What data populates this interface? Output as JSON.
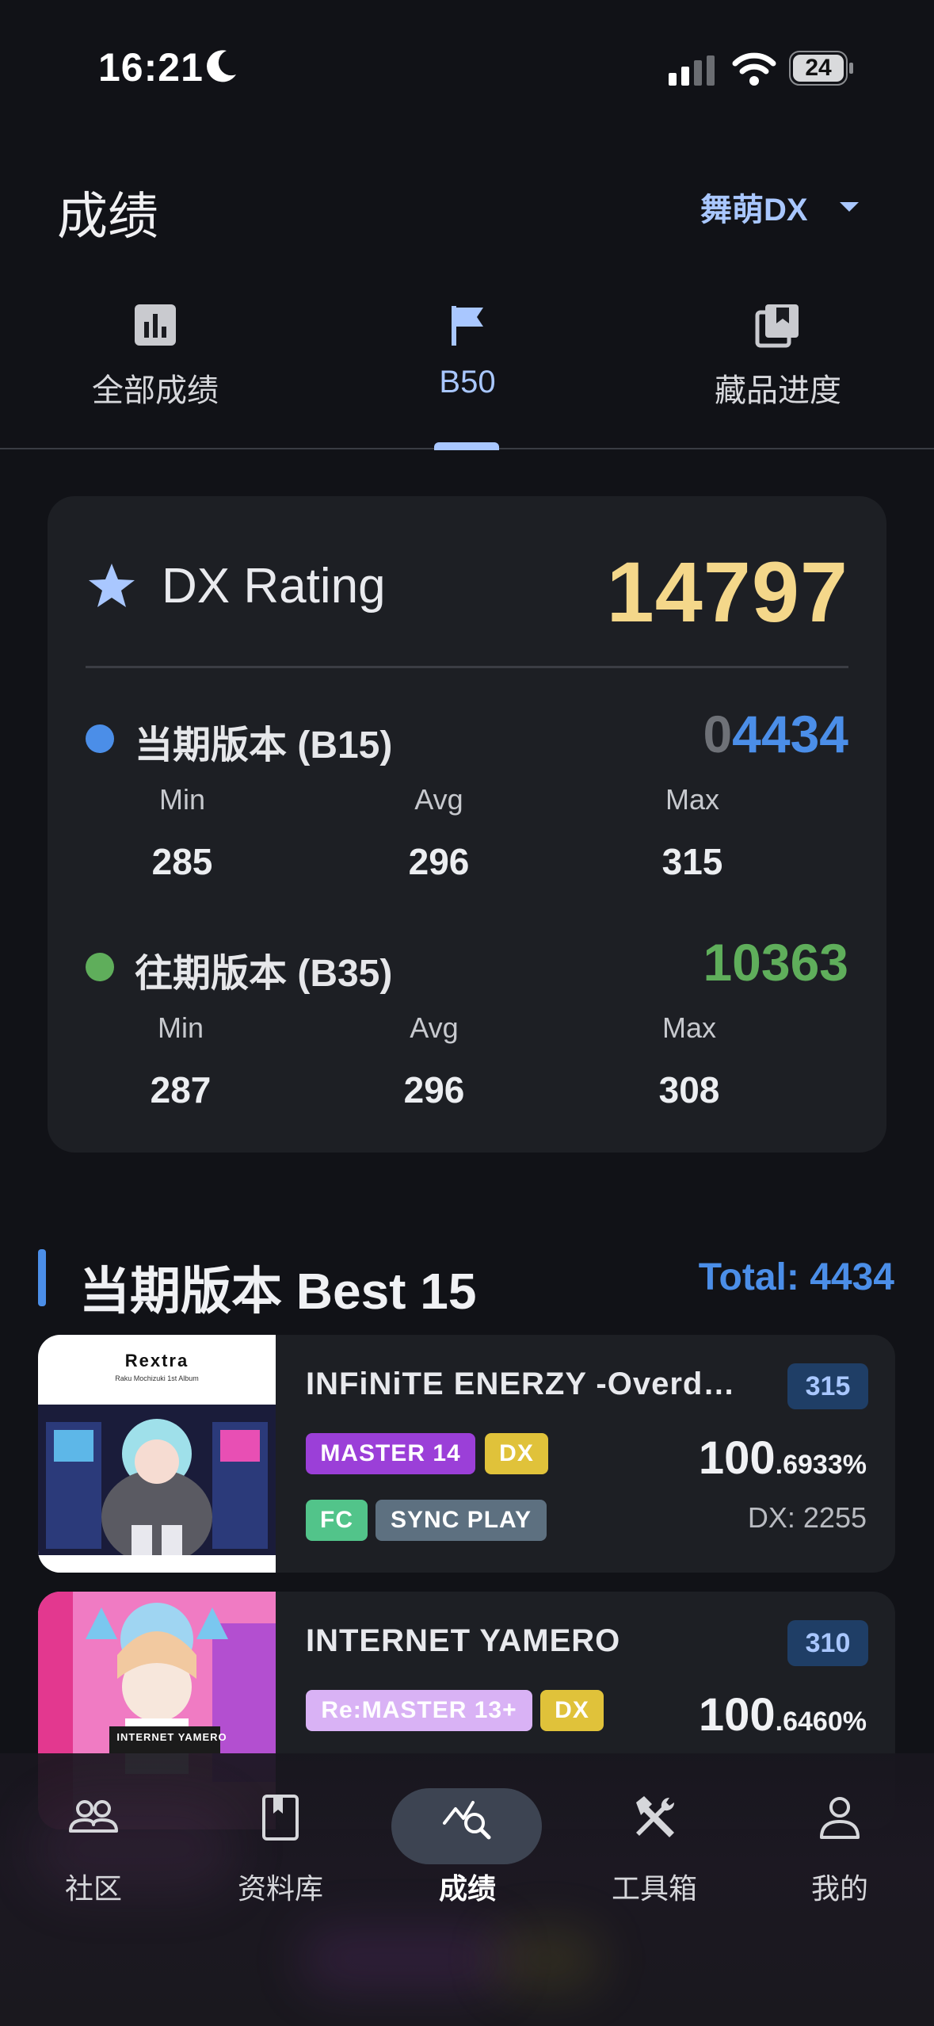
{
  "status_bar": {
    "time": "16:21",
    "battery": "24"
  },
  "header": {
    "title": "成绩",
    "game_selector": "舞萌DX"
  },
  "tabs": [
    {
      "label": "全部成绩",
      "icon": "bar-chart-icon"
    },
    {
      "label": "B50",
      "icon": "flag-icon",
      "active": true
    },
    {
      "label": "藏品进度",
      "icon": "collection-icon"
    }
  ],
  "rating_card": {
    "label": "DX Rating",
    "value": "14797",
    "current": {
      "label": "当期版本 (B15)",
      "value_prefix": "0",
      "value": "4434",
      "min_label": "Min",
      "min": "285",
      "avg_label": "Avg",
      "avg": "296",
      "max_label": "Max",
      "max": "315"
    },
    "past": {
      "label": "往期版本 (B35)",
      "value": "10363",
      "min_label": "Min",
      "min": "287",
      "avg_label": "Avg",
      "avg": "296",
      "max_label": "Max",
      "max": "308"
    }
  },
  "best15": {
    "title": "当期版本 Best 15",
    "total": "Total: 4434",
    "songs": [
      {
        "title": "INFiNiTE ENERZY -Overdose-",
        "level": "315",
        "difficulty": "MASTER 14",
        "type": "DX",
        "tags": [
          "FC",
          "SYNC PLAY"
        ],
        "score_int": "100",
        "score_dec": ".6933%",
        "dx_score": "DX: 2255",
        "cover_text": "Rextra",
        "cover_subtext": "Raku Mochizuki 1st Album"
      },
      {
        "title": "INTERNET YAMERO",
        "level": "310",
        "difficulty": "Re:MASTER 13+",
        "type": "DX",
        "score_int": "100",
        "score_dec": ".6460%",
        "cover_text": "INTERNET YAMERO"
      }
    ]
  },
  "bottom_nav": [
    {
      "label": "社区",
      "icon": "community-icon"
    },
    {
      "label": "资料库",
      "icon": "book-icon"
    },
    {
      "label": "成绩",
      "icon": "score-search-icon",
      "active": true
    },
    {
      "label": "工具箱",
      "icon": "tools-icon"
    },
    {
      "label": "我的",
      "icon": "profile-icon"
    }
  ],
  "colors": {
    "accent": "#a9c7ff",
    "rating_gold": "#f4d78a",
    "current_blue": "#4b8ee8",
    "past_green": "#5fae5b",
    "master_purple": "#9b3fd8",
    "remaster_lilac": "#d9b2f5",
    "dx_yellow": "#e0c23a",
    "fc_green": "#52c48a",
    "sync_gray": "#5d7080"
  }
}
